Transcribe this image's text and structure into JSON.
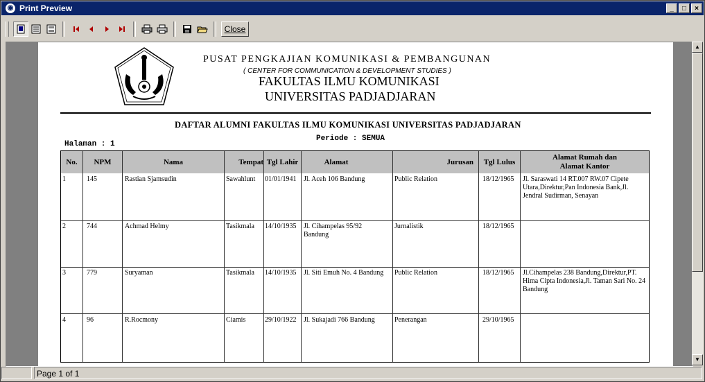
{
  "window": {
    "title": "Print Preview"
  },
  "toolbar": {
    "close_label": "Close",
    "icons": [
      "single-page-icon",
      "multi-page-icon",
      "fit-page-icon",
      "first-page-icon",
      "prev-page-icon",
      "next-page-icon",
      "last-page-icon",
      "print-setup-icon",
      "print-icon",
      "save-icon",
      "open-icon"
    ]
  },
  "report": {
    "org_line1": "PUSAT PENGKAJIAN KOMUNIKASI & PEMBANGUNAN",
    "org_line2": "( CENTER FOR COMMUNICATION & DEVELOPMENT STUDIES )",
    "org_line3": "FAKULTAS ILMU KOMUNIKASI",
    "org_line4": "UNIVERSITAS PADJADJARAN",
    "report_title": "DAFTAR ALUMNI FAKULTAS ILMU KOMUNIKASI UNIVERSITAS PADJADJARAN",
    "periode": "Periode : SEMUA",
    "halaman": "Halaman : 1",
    "columns": [
      "No.",
      "NPM",
      "Nama",
      "Tempat",
      "Tgl Lahir",
      "Alamat",
      "Jurusan",
      "Tgl Lulus",
      "Alamat Rumah dan\nAlamat Kantor"
    ],
    "rows": [
      [
        "1",
        "145",
        "Rastian Sjamsudin",
        "Sawahlunt",
        "01/01/1941",
        "Jl. Aceh 106 Bandung",
        "Public Relation",
        "18/12/1965",
        "Jl. Saraswati 14 RT.007 RW.07 Cipete Utara,Direktur,Pan Indonesia Bank,Jl. Jendral Sudirman, Senayan"
      ],
      [
        "2",
        "744",
        "Achmad Helmy",
        "Tasikmala",
        "14/10/1935",
        "Jl. Cihampelas 95/92 Bandung",
        "Jurnalistik",
        "18/12/1965",
        ""
      ],
      [
        "3",
        "779",
        "Suryaman",
        "Tasikmala",
        "14/10/1935",
        "Jl. Siti Emuh No. 4 Bandung",
        "Public Relation",
        "18/12/1965",
        "Jl.Cihampelas 238 Bandung,Direktur,PT. Hima Cipta Indonesia,Jl. Taman Sari No. 24 Bandung"
      ],
      [
        "4",
        "96",
        "R.Rocmony",
        "Ciamis",
        "29/10/1922",
        "Jl. Sukajadi 766 Bandung",
        "Penerangan",
        "29/10/1965",
        ""
      ]
    ]
  },
  "status": {
    "page_info": "Page 1 of 1"
  }
}
